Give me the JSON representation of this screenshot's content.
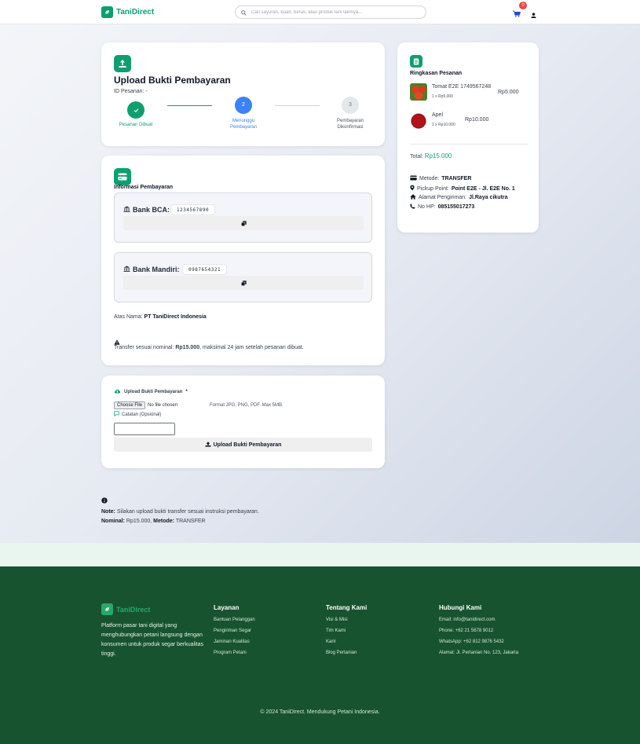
{
  "header": {
    "brand": "TaniDirect",
    "search_placeholder": "Cari sayuran, buah, beras, atau produk tani lainnya...",
    "cart_count": "0"
  },
  "upload": {
    "title": "Upload Bukti Pembayaran",
    "order_id": "ID Pesanan: -",
    "steps": [
      {
        "number": "1",
        "label": "Pesanan Dibuat",
        "status": "done"
      },
      {
        "number": "2",
        "label": "Menunggu Pembayaran",
        "status": "active"
      },
      {
        "number": "3",
        "label": "Pembayaran Dikonfirmasi",
        "status": "pending"
      }
    ]
  },
  "payment_info": {
    "title": "Informasi Pembayaran",
    "banks": [
      {
        "name": "Bank BCA:",
        "account": "1234567890"
      },
      {
        "name": "Bank Mandiri:",
        "account": "0987654321"
      }
    ],
    "account_holder_label": "Atas Nama:",
    "account_holder": "PT TaniDirect Indonesia",
    "transfer_prefix": "Transfer sesuai nominal:",
    "transfer_amount": "Rp15.000",
    "transfer_suffix": ", maksimal 24 jam setelah pesanan dibuat."
  },
  "upload_form": {
    "label": "Upload Bukti Pembayaran",
    "required_mark": "*",
    "file_button": "Choose File",
    "file_status": "No file chosen",
    "format_hint": "Format JPG, PNG, PDF. Max 5MB.",
    "notes_label": "Catatan (Opsional)",
    "submit_label": "Upload Bukti Pembayaran"
  },
  "summary": {
    "title": "Ringkasan Pesanan",
    "items": [
      {
        "name": "Tomat E2E 1749567248",
        "qty": "1 x Rp5.000",
        "price": "Rp5.000"
      },
      {
        "name": "Apel",
        "qty": "1 x Rp10.000",
        "price": "Rp10.000"
      }
    ],
    "total_label": "Total:",
    "total_value": "Rp15.000",
    "method_label": "Metode:",
    "method_value": "TRANSFER",
    "pickup_label": "Pickup Point:",
    "pickup_value": "Point E2E - Jl. E2E No. 1",
    "address_label": "Alamat Pengiriman:",
    "address_value": "Jl.Raya cikutra",
    "phone_label": "No HP:",
    "phone_value": "085155017273"
  },
  "note": {
    "label": "Note:",
    "text": "Silakan upload bukti transfer sesuai instruksi pembayaran.",
    "nominal_label": "Nominal:",
    "nominal_value": "Rp15.000,",
    "method_label": "Metode:",
    "method_value": "TRANSFER"
  },
  "footer": {
    "brand": "TaniDirect",
    "description": "Platform pasar tani digital yang menghubungkan petani langsung dengan konsumen untuk produk segar berkualitas tinggi.",
    "columns": [
      {
        "title": "Layanan",
        "links": [
          "Bantuan Pelanggan",
          "Pengiriman Segar",
          "Jaminan Kualitas",
          "Program Petani"
        ]
      },
      {
        "title": "Tentang Kami",
        "links": [
          "Visi & Misi",
          "Tim Kami",
          "Karir",
          "Blog Pertanian"
        ]
      },
      {
        "title": "Hubungi Kami",
        "links": [
          "Email: info@tanidirect.com",
          "Phone: +62 21 5678 9012",
          "WhatsApp: +62 812 9876 5432",
          "Alamat: Jl. Pertanian No. 123, Jakarta"
        ]
      }
    ],
    "copyright": "© 2024 TaniDirect. Mendukung Petani Indonesia."
  },
  "colors": {
    "brand": "#0f9f6e",
    "active_step": "#3b82f6",
    "footer_bg": "#17532f",
    "badge": "#ef4444"
  },
  "icons": [
    "leaf-logo-icon",
    "search-icon",
    "cart-icon",
    "user-icon",
    "upload-icon",
    "check-icon",
    "credit-card-icon",
    "bank-icon",
    "copy-icon",
    "warning-icon",
    "cloud-upload-icon",
    "comment-icon",
    "receipt-icon",
    "map-pin-icon",
    "home-icon",
    "phone-icon",
    "info-icon"
  ]
}
